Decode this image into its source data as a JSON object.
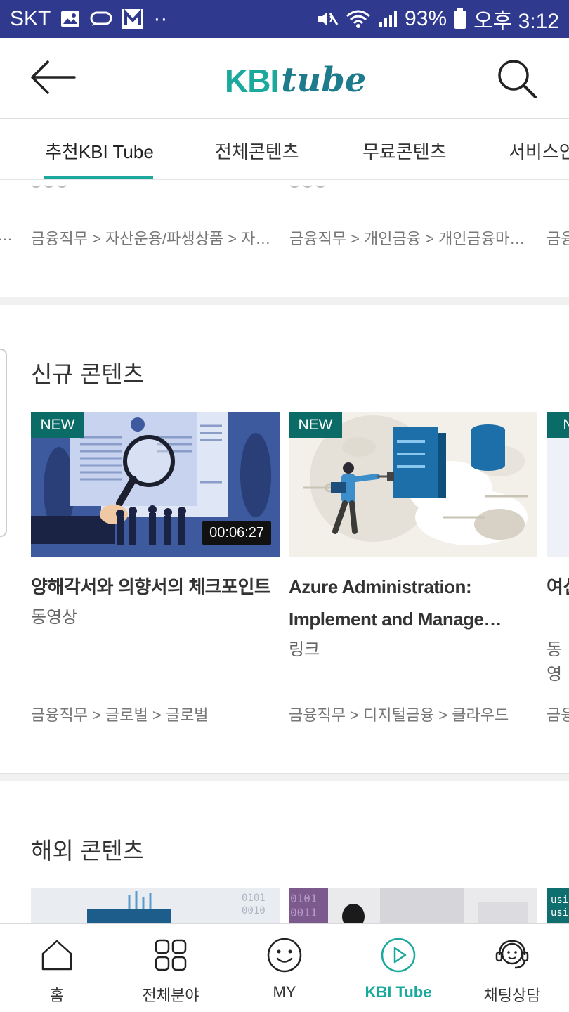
{
  "status_bar": {
    "carrier": "SKT",
    "battery": "93%",
    "time": "오후 3:12"
  },
  "header": {
    "logo_kbi": "KBI",
    "logo_tube": "tube"
  },
  "tabs": [
    {
      "label": "추천KBI Tube",
      "active": true
    },
    {
      "label": "전체콘텐츠",
      "active": false
    },
    {
      "label": "무료콘텐츠",
      "active": false
    },
    {
      "label": "서비스안",
      "active": false
    }
  ],
  "prev_section": {
    "breadcrumbs": [
      "…",
      "금융직무 > 자산운용/파생상품 > 자…",
      "금융직무 > 개인금융 > 개인금융마…",
      "금융"
    ]
  },
  "new_contents": {
    "title": "신규 콘텐츠",
    "items": [
      {
        "badge": "NEW",
        "duration": "00:06:27",
        "title": "양해각서와 의향서의 체크포인트",
        "type": "동영상",
        "breadcrumb": "금융직무 > 글로벌 > 글로벌"
      },
      {
        "badge": "NEW",
        "title": "Azure Administration: Implement and Manage…",
        "type": "링크",
        "breadcrumb": "금융직무 > 디지털금융 > 클라우드"
      },
      {
        "badge": "NE",
        "title": "여신권",
        "type": "동영",
        "breadcrumb": "금융"
      }
    ]
  },
  "overseas_contents": {
    "title": "해외 콘텐츠",
    "code_snippet": [
      "usi",
      "usi"
    ]
  },
  "bottom_nav": [
    {
      "label": "홈",
      "icon": "home-icon",
      "active": false
    },
    {
      "label": "전체분야",
      "icon": "grid-icon",
      "active": false
    },
    {
      "label": "MY",
      "icon": "smile-icon",
      "active": false
    },
    {
      "label": "KBI Tube",
      "icon": "play-circle-icon",
      "active": true
    },
    {
      "label": "채팅상담",
      "icon": "headset-icon",
      "active": false
    }
  ],
  "colors": {
    "status_bar": "#2f3a8f",
    "accent": "#1aa99c",
    "badge": "#0b6b66"
  }
}
